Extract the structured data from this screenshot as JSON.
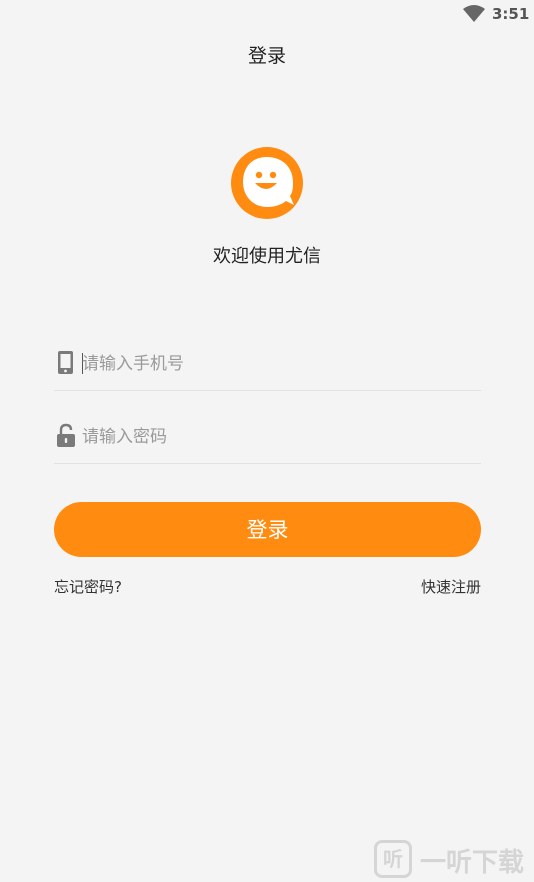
{
  "status_bar": {
    "time": "3:51",
    "wifi_icon": "wifi-icon"
  },
  "header": {
    "title": "登录"
  },
  "brand": {
    "logo_icon": "smiley-chat-icon",
    "welcome": "欢迎使用尤信",
    "accent": "#ff8c10"
  },
  "form": {
    "phone": {
      "icon": "phone-icon",
      "placeholder": "请输入手机号",
      "value": ""
    },
    "password": {
      "icon": "lock-icon",
      "placeholder": "请输入密码",
      "value": ""
    },
    "submit_label": "登录"
  },
  "links": {
    "forgot": "忘记密码?",
    "register": "快速注册"
  },
  "watermark": {
    "mark": "听",
    "text": "一听下载"
  }
}
